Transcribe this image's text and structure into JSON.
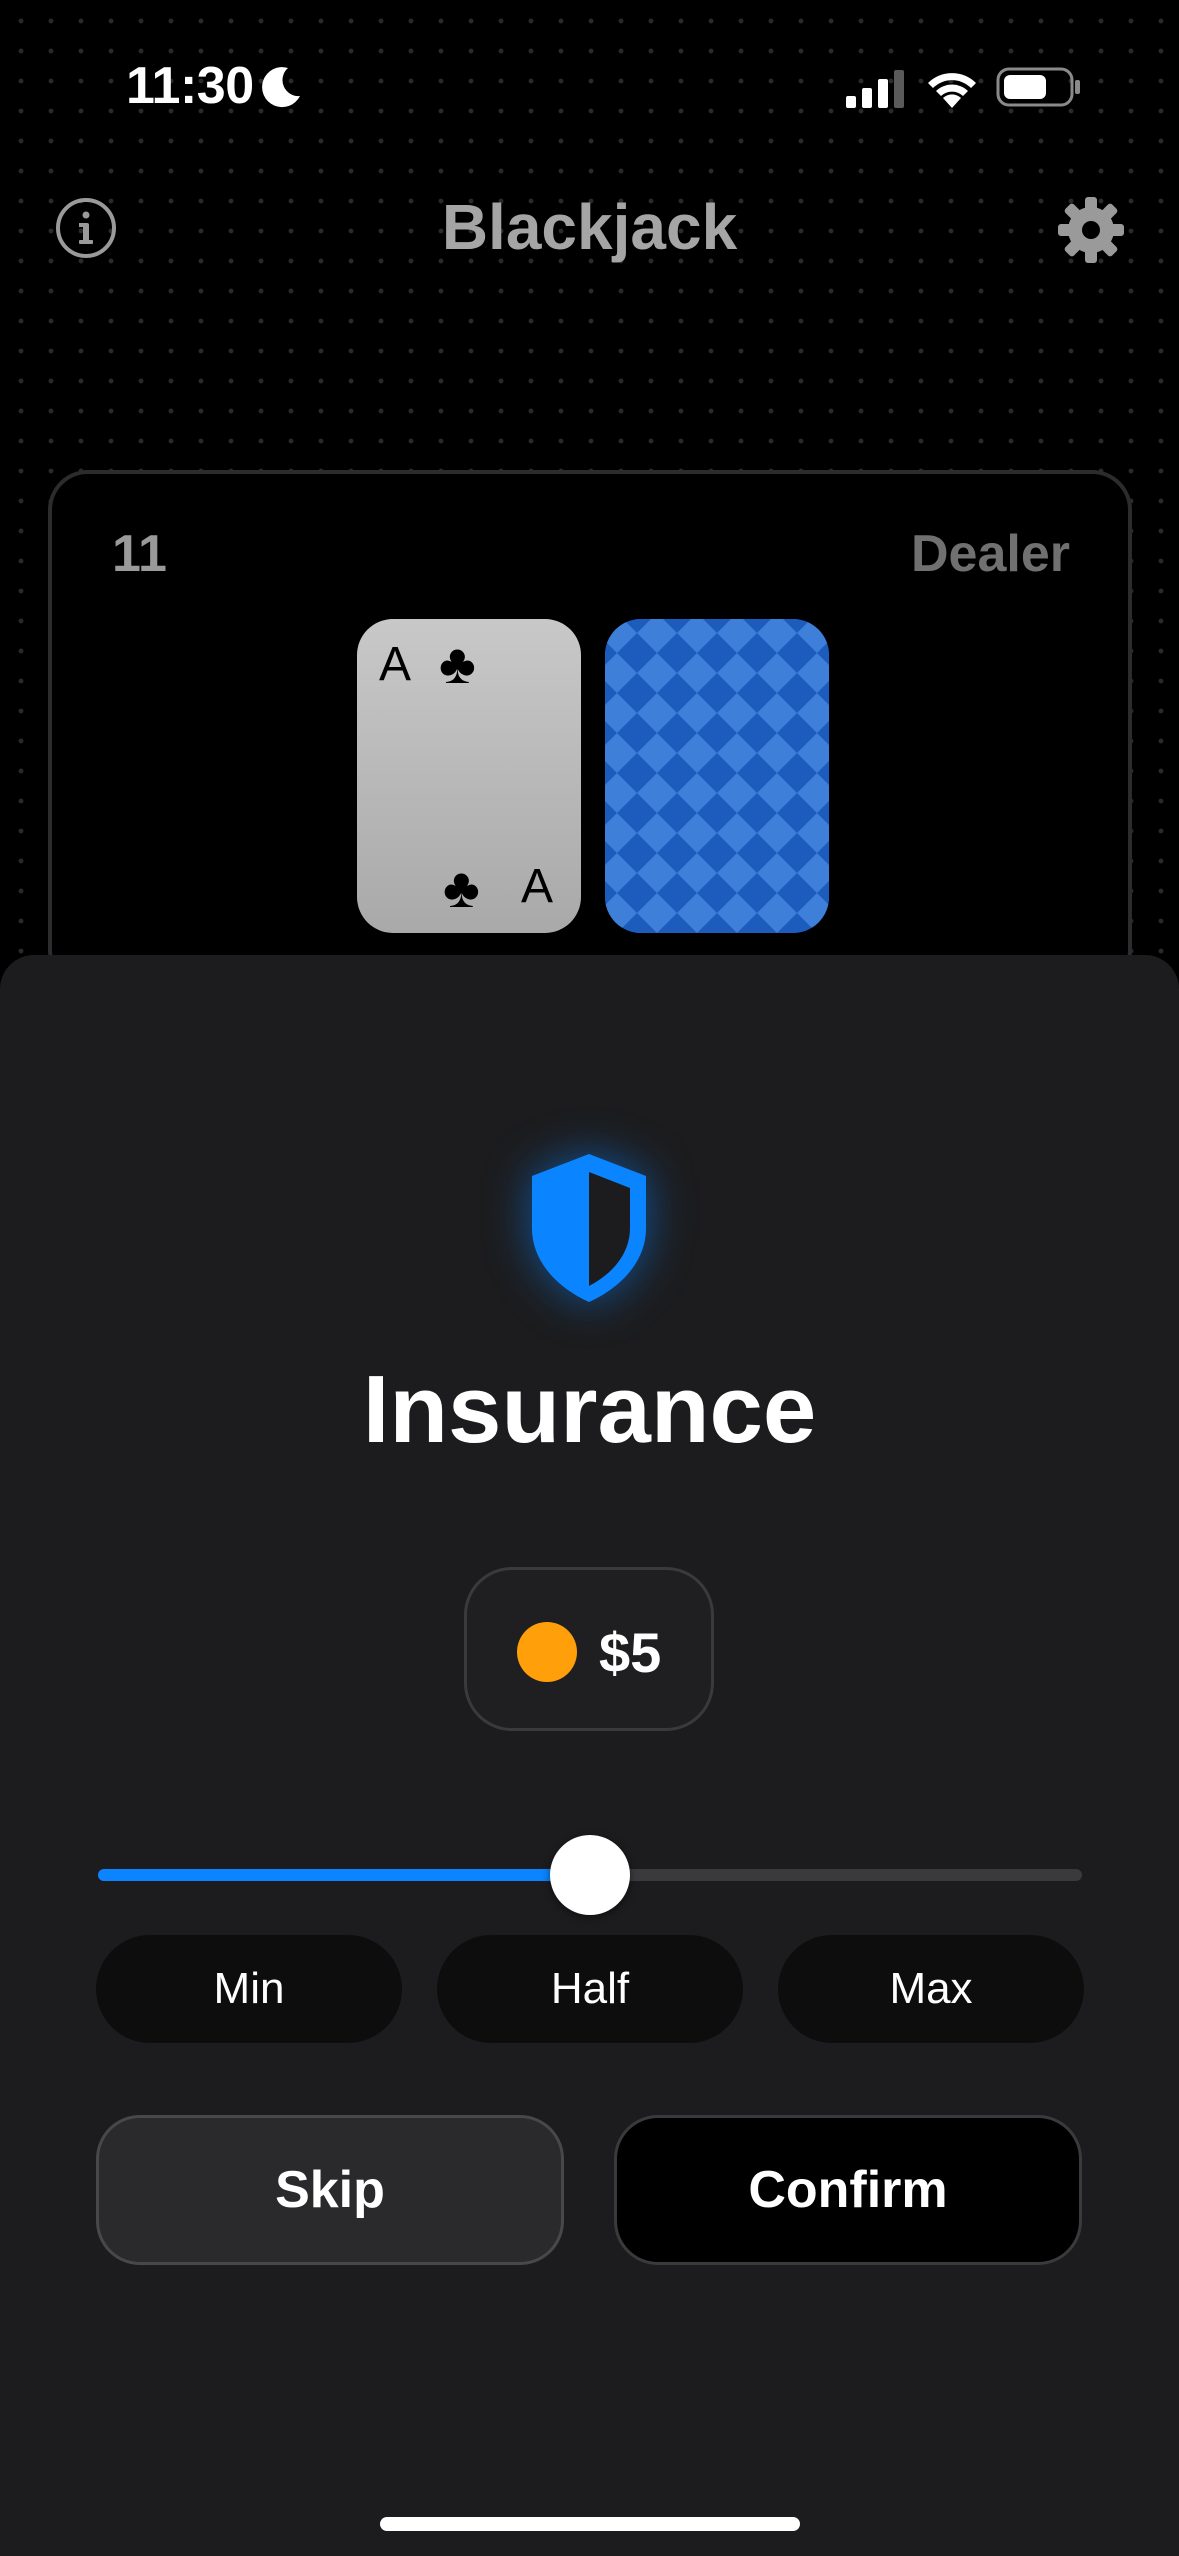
{
  "status_bar": {
    "time": "11:30",
    "icons": [
      "moon-icon",
      "cellular-signal-icon",
      "wifi-icon",
      "battery-icon"
    ]
  },
  "header": {
    "title": "Blackjack",
    "info_icon": "info-icon",
    "settings_icon": "gear-icon"
  },
  "dealer": {
    "count": "11",
    "label": "Dealer",
    "cards": [
      {
        "rank": "A",
        "suit": "♣",
        "face_up": true
      },
      {
        "face_up": false
      }
    ]
  },
  "insurance": {
    "icon": "shield-icon",
    "title": "Insurance",
    "amount": "$5",
    "slider_fraction": 0.5,
    "presets": [
      "Min",
      "Half",
      "Max"
    ],
    "skip_label": "Skip",
    "confirm_label": "Confirm"
  },
  "colors": {
    "accent": "#0a84ff",
    "coin": "#ff9f0a",
    "card_back": "#1f5fbf",
    "sheet_bg": "#1c1c1e"
  }
}
